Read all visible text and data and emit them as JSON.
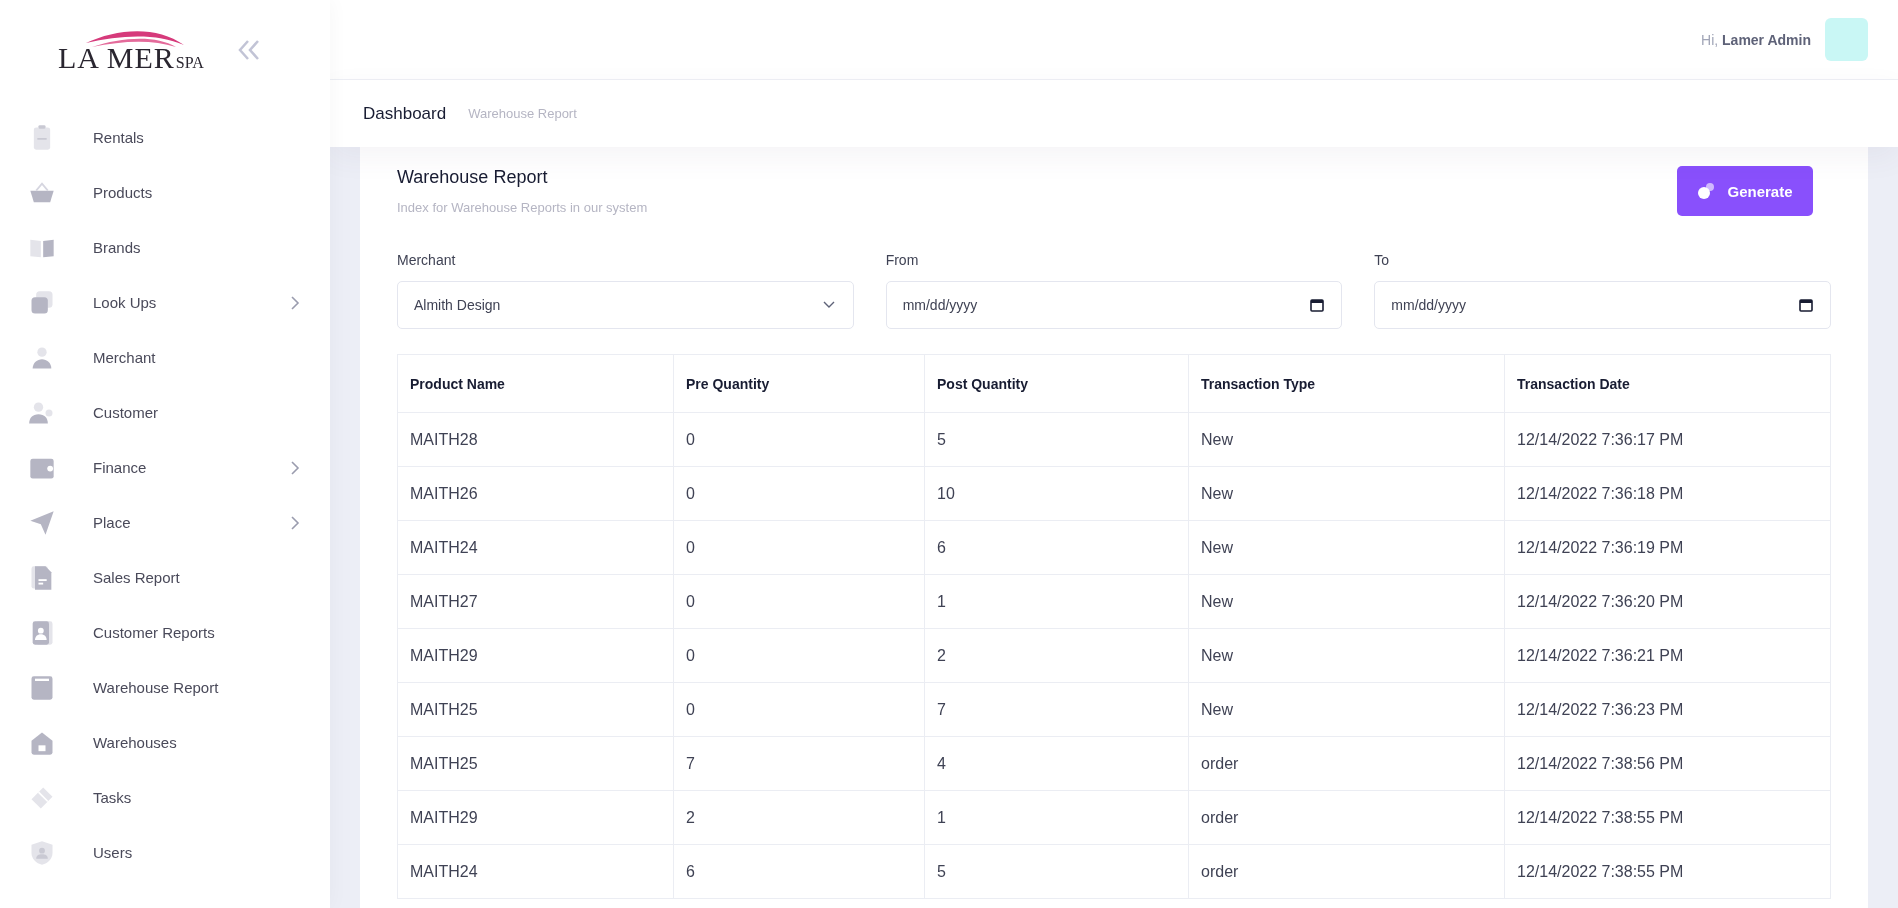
{
  "logo": {
    "name": "LA MER",
    "suffix": "SPA"
  },
  "sidebar": {
    "items": [
      {
        "label": "Rentals",
        "has_submenu": false
      },
      {
        "label": "Products",
        "has_submenu": false
      },
      {
        "label": "Brands",
        "has_submenu": false
      },
      {
        "label": "Look Ups",
        "has_submenu": true
      },
      {
        "label": "Merchant",
        "has_submenu": false
      },
      {
        "label": "Customer",
        "has_submenu": false
      },
      {
        "label": "Finance",
        "has_submenu": true
      },
      {
        "label": "Place",
        "has_submenu": true
      },
      {
        "label": "Sales Report",
        "has_submenu": false
      },
      {
        "label": "Customer Reports",
        "has_submenu": false
      },
      {
        "label": "Warehouse Report",
        "has_submenu": false
      },
      {
        "label": "Warehouses",
        "has_submenu": false
      },
      {
        "label": "Tasks",
        "has_submenu": false
      },
      {
        "label": "Users",
        "has_submenu": false
      }
    ]
  },
  "header": {
    "greeting": "Hi,",
    "user": "Lamer Admin"
  },
  "breadcrumb": {
    "title": "Dashboard",
    "current": "Warehouse Report"
  },
  "report": {
    "title": "Warehouse Report",
    "subtitle": "Index for Warehouse Reports in our system",
    "generate_button": "Generate",
    "filters": [
      {
        "kind": "select",
        "label": "Merchant",
        "value": "Almith Design"
      },
      {
        "kind": "date",
        "label": "From",
        "placeholder": "mm/dd/yyyy"
      },
      {
        "kind": "date",
        "label": "To",
        "placeholder": "mm/dd/yyyy"
      }
    ]
  },
  "table": {
    "columns": [
      "Product Name",
      "Pre Quantity",
      "Post Quantity",
      "Transaction Type",
      "Transaction Date"
    ],
    "rows": [
      [
        "MAITH28",
        "0",
        "5",
        "New",
        "12/14/2022 7:36:17 PM"
      ],
      [
        "MAITH26",
        "0",
        "10",
        "New",
        "12/14/2022 7:36:18 PM"
      ],
      [
        "MAITH24",
        "0",
        "6",
        "New",
        "12/14/2022 7:36:19 PM"
      ],
      [
        "MAITH27",
        "0",
        "1",
        "New",
        "12/14/2022 7:36:20 PM"
      ],
      [
        "MAITH29",
        "0",
        "2",
        "New",
        "12/14/2022 7:36:21 PM"
      ],
      [
        "MAITH25",
        "0",
        "7",
        "New",
        "12/14/2022 7:36:23 PM"
      ],
      [
        "MAITH25",
        "7",
        "4",
        "order",
        "12/14/2022 7:38:56 PM"
      ],
      [
        "MAITH29",
        "2",
        "1",
        "order",
        "12/14/2022 7:38:55 PM"
      ],
      [
        "MAITH24",
        "6",
        "5",
        "order",
        "12/14/2022 7:38:55 PM"
      ]
    ]
  }
}
